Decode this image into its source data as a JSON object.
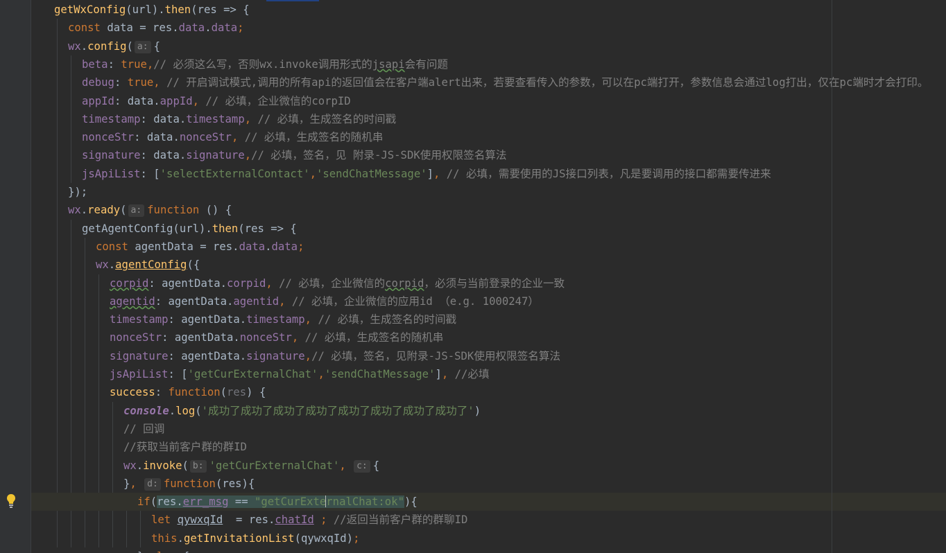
{
  "editor": {
    "theme_colors": {
      "background": "#2b2b2b",
      "gutter": "#313335",
      "keyword": "#cc7832",
      "function": "#ffc66d",
      "property": "#9876aa",
      "string": "#6a8759",
      "comment": "#808080",
      "plain": "#a9b7c6"
    },
    "lightbulb_icon": "lightbulb-icon",
    "lines": [
      {
        "indent": 0,
        "tokens": [
          [
            "fn",
            "getWxConfig"
          ],
          [
            "plain",
            "(url)."
          ],
          [
            "fn",
            "then"
          ],
          [
            "plain",
            "(res => {"
          ]
        ]
      },
      {
        "indent": 1,
        "tokens": [
          [
            "kw",
            "const "
          ],
          [
            "plain",
            "data = res."
          ],
          [
            "prop",
            "data"
          ],
          [
            "plain",
            "."
          ],
          [
            "prop",
            "data"
          ],
          [
            "kw",
            ";"
          ]
        ]
      },
      {
        "indent": 1,
        "tokens": [
          [
            "prop",
            "wx"
          ],
          [
            "plain",
            "."
          ],
          [
            "fn",
            "config"
          ],
          [
            "plain",
            "("
          ],
          [
            "hint",
            "a:"
          ],
          [
            "plain",
            "{"
          ]
        ]
      },
      {
        "indent": 2,
        "tokens": [
          [
            "prop",
            "beta"
          ],
          [
            "plain",
            ": "
          ],
          [
            "kw",
            "true,"
          ],
          [
            "cmt",
            "// 必须这么写，否则wx.invoke调用形式的"
          ],
          [
            "cmtu",
            "jsapi"
          ],
          [
            "cmt",
            "会有问题"
          ]
        ]
      },
      {
        "indent": 2,
        "tokens": [
          [
            "prop",
            "debug"
          ],
          [
            "plain",
            ": "
          ],
          [
            "kw",
            "true, "
          ],
          [
            "cmt",
            "// 开启调试模式,调用的所有api的返回值会在客户端alert出来，若要查看传入的参数，可以在pc端打开，参数信息会通过log打出，仅在pc端时才会打印。"
          ]
        ]
      },
      {
        "indent": 2,
        "tokens": [
          [
            "prop",
            "appId"
          ],
          [
            "plain",
            ": data."
          ],
          [
            "prop",
            "appId"
          ],
          [
            "kw",
            ", "
          ],
          [
            "cmt",
            "// 必填，企业微信的corpID"
          ]
        ]
      },
      {
        "indent": 2,
        "tokens": [
          [
            "prop",
            "timestamp"
          ],
          [
            "plain",
            ": data."
          ],
          [
            "prop",
            "timestamp"
          ],
          [
            "kw",
            ", "
          ],
          [
            "cmt",
            "// 必填，生成签名的时间戳"
          ]
        ]
      },
      {
        "indent": 2,
        "tokens": [
          [
            "prop",
            "nonceStr"
          ],
          [
            "plain",
            ": data."
          ],
          [
            "prop",
            "nonceStr"
          ],
          [
            "kw",
            ", "
          ],
          [
            "cmt",
            "// 必填，生成签名的随机串"
          ]
        ]
      },
      {
        "indent": 2,
        "tokens": [
          [
            "prop",
            "signature"
          ],
          [
            "plain",
            ": data."
          ],
          [
            "prop",
            "signature"
          ],
          [
            "kw",
            ","
          ],
          [
            "cmt",
            "// 必填，签名，见 附录-JS-SDK使用权限签名算法"
          ]
        ]
      },
      {
        "indent": 2,
        "tokens": [
          [
            "prop",
            "jsApiList"
          ],
          [
            "plain",
            ": ["
          ],
          [
            "str",
            "'selectExternalContact'"
          ],
          [
            "kw",
            ","
          ],
          [
            "str",
            "'sendChatMessage'"
          ],
          [
            "plain",
            "]"
          ],
          [
            "kw",
            ", "
          ],
          [
            "cmt",
            "// 必填，需要使用的JS接口列表，凡是要调用的接口都需要传进来"
          ]
        ]
      },
      {
        "indent": 1,
        "tokens": [
          [
            "plain",
            "});"
          ]
        ]
      },
      {
        "indent": 1,
        "tokens": [
          [
            "prop",
            "wx"
          ],
          [
            "plain",
            "."
          ],
          [
            "fn",
            "ready"
          ],
          [
            "plain",
            "("
          ],
          [
            "hint",
            "a:"
          ],
          [
            "kw",
            "function "
          ],
          [
            "plain",
            "() {"
          ]
        ]
      },
      {
        "indent": 2,
        "tokens": [
          [
            "plain",
            "getAgentConfig(url)."
          ],
          [
            "fn",
            "then"
          ],
          [
            "plain",
            "(res => {"
          ]
        ]
      },
      {
        "indent": 3,
        "tokens": [
          [
            "kw",
            "const "
          ],
          [
            "plain",
            "agentData = res."
          ],
          [
            "prop",
            "data"
          ],
          [
            "plain",
            "."
          ],
          [
            "prop",
            "data"
          ],
          [
            "kw",
            ";"
          ]
        ]
      },
      {
        "indent": 3,
        "tokens": [
          [
            "prop",
            "wx"
          ],
          [
            "plain",
            "."
          ],
          [
            "fnu",
            "agentConfig"
          ],
          [
            "plain",
            "({"
          ]
        ]
      },
      {
        "indent": 4,
        "tokens": [
          [
            "propw",
            "corpid"
          ],
          [
            "plain",
            ": agentData."
          ],
          [
            "prop",
            "corpid"
          ],
          [
            "kw",
            ", "
          ],
          [
            "cmt",
            "// 必填，企业微信的"
          ],
          [
            "cmtw",
            "corpid"
          ],
          [
            "cmt",
            "，必须与当前登录的企业一致"
          ]
        ]
      },
      {
        "indent": 4,
        "tokens": [
          [
            "propw",
            "agentid"
          ],
          [
            "plain",
            ": agentData."
          ],
          [
            "prop",
            "agentid"
          ],
          [
            "kw",
            ", "
          ],
          [
            "cmt",
            "// 必填，企业微信的应用id （e.g. 1000247）"
          ]
        ]
      },
      {
        "indent": 4,
        "tokens": [
          [
            "prop",
            "timestamp"
          ],
          [
            "plain",
            ": agentData."
          ],
          [
            "prop",
            "timestamp"
          ],
          [
            "kw",
            ", "
          ],
          [
            "cmt",
            "// 必填，生成签名的时间戳"
          ]
        ]
      },
      {
        "indent": 4,
        "tokens": [
          [
            "prop",
            "nonceStr"
          ],
          [
            "plain",
            ": agentData."
          ],
          [
            "prop",
            "nonceStr"
          ],
          [
            "kw",
            ", "
          ],
          [
            "cmt",
            "// 必填，生成签名的随机串"
          ]
        ]
      },
      {
        "indent": 4,
        "tokens": [
          [
            "prop",
            "signature"
          ],
          [
            "plain",
            ": agentData."
          ],
          [
            "prop",
            "signature"
          ],
          [
            "kw",
            ","
          ],
          [
            "cmt",
            "// 必填，签名，见附录-JS-SDK使用权限签名算法"
          ]
        ]
      },
      {
        "indent": 4,
        "tokens": [
          [
            "prop",
            "jsApiList"
          ],
          [
            "plain",
            ": ["
          ],
          [
            "str",
            "'getCurExternalChat'"
          ],
          [
            "kw",
            ","
          ],
          [
            "str",
            "'sendChatMessage'"
          ],
          [
            "plain",
            "]"
          ],
          [
            "kw",
            ", "
          ],
          [
            "cmt",
            "//必填"
          ]
        ]
      },
      {
        "indent": 4,
        "tokens": [
          [
            "fn",
            "success"
          ],
          [
            "plain",
            ": "
          ],
          [
            "kw",
            "function"
          ],
          [
            "plain",
            "("
          ],
          [
            "param",
            "res"
          ],
          [
            "plain",
            ") {"
          ]
        ]
      },
      {
        "indent": 5,
        "tokens": [
          [
            "ital",
            "console"
          ],
          [
            "plain",
            "."
          ],
          [
            "fn",
            "log"
          ],
          [
            "plain",
            "("
          ],
          [
            "str",
            "'成功了成功了成功了成功了成功了成功了成功了成功了'"
          ],
          [
            "plain",
            ")"
          ]
        ]
      },
      {
        "indent": 5,
        "tokens": [
          [
            "cmt",
            "// 回调"
          ]
        ]
      },
      {
        "indent": 5,
        "tokens": [
          [
            "cmt",
            "//获取当前客户群的群ID"
          ]
        ]
      },
      {
        "indent": 5,
        "tokens": [
          [
            "prop",
            "wx"
          ],
          [
            "plain",
            "."
          ],
          [
            "fn",
            "invoke"
          ],
          [
            "plain",
            "("
          ],
          [
            "hint",
            "b:"
          ],
          [
            "str",
            "'getCurExternalChat'"
          ],
          [
            "kw",
            ", "
          ],
          [
            "hint",
            "c:"
          ],
          [
            "plain",
            "{"
          ]
        ]
      },
      {
        "indent": 5,
        "tokens": [
          [
            "plain",
            "}"
          ],
          [
            "kw",
            ", "
          ],
          [
            "hint",
            "d:"
          ],
          [
            "kw",
            "function"
          ],
          [
            "plain",
            "(res){"
          ]
        ]
      },
      {
        "indent": 6,
        "current": true,
        "tokens": [
          [
            "kw",
            "if"
          ],
          [
            "plain",
            "("
          ],
          [
            "matchplain",
            "res."
          ],
          [
            "matchpropu",
            "err_msg"
          ],
          [
            "matchplain",
            " == "
          ],
          [
            "matchstr",
            "\"getCurExte"
          ],
          [
            "caret",
            ""
          ],
          [
            "matchstr",
            "rnalChat:ok\""
          ],
          [
            "plain",
            "){"
          ]
        ]
      },
      {
        "indent": 7,
        "tokens": [
          [
            "kw",
            "let "
          ],
          [
            "plainu",
            "qywxqId"
          ],
          [
            "plain",
            "  = res."
          ],
          [
            "propu",
            "chatId"
          ],
          [
            "plain",
            " "
          ],
          [
            "kw",
            ";"
          ],
          [
            "plain",
            " "
          ],
          [
            "cmt",
            "//返回当前客户群的群聊ID"
          ]
        ]
      },
      {
        "indent": 7,
        "tokens": [
          [
            "kw",
            "this"
          ],
          [
            "plain",
            "."
          ],
          [
            "fn",
            "getInvitationList"
          ],
          [
            "plain",
            "(qywxqId)"
          ],
          [
            "kw",
            ";"
          ]
        ]
      },
      {
        "indent": 6,
        "tokens": [
          [
            "plain",
            "} "
          ],
          [
            "kw",
            "else "
          ],
          [
            "plain",
            "{"
          ]
        ]
      }
    ]
  }
}
